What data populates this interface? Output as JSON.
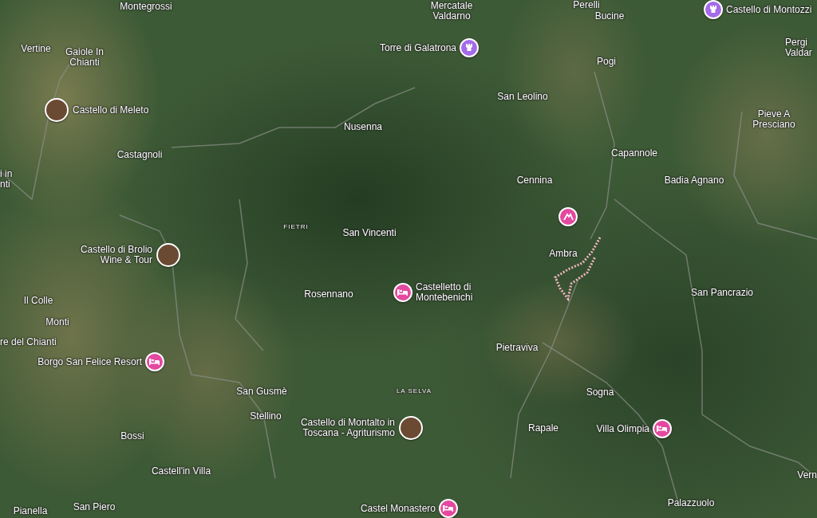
{
  "map": {
    "places": [
      {
        "name": "Montegrossi",
        "kind": "town"
      },
      {
        "name": "Mercatale Valdarno",
        "kind": "town"
      },
      {
        "name": "Perelli",
        "kind": "town"
      },
      {
        "name": "Bucine",
        "kind": "town"
      },
      {
        "name": "Pergi Valdar",
        "kind": "town"
      },
      {
        "name": "Vertine",
        "kind": "town"
      },
      {
        "name": "Gaiole In Chianti",
        "kind": "town"
      },
      {
        "name": "Pogi",
        "kind": "town"
      },
      {
        "name": "San Leolino",
        "kind": "town"
      },
      {
        "name": "Nusenna",
        "kind": "town"
      },
      {
        "name": "Pieve A Presciano",
        "kind": "town"
      },
      {
        "name": "Capannole",
        "kind": "town"
      },
      {
        "name": "Castagnoli",
        "kind": "town"
      },
      {
        "name": "i in nti",
        "kind": "town"
      },
      {
        "name": "Cennina",
        "kind": "town"
      },
      {
        "name": "Badia Agnano",
        "kind": "town"
      },
      {
        "name": "FIETRI",
        "kind": "area"
      },
      {
        "name": "San Vincenti",
        "kind": "town"
      },
      {
        "name": "Ambra",
        "kind": "town"
      },
      {
        "name": "Rosennano",
        "kind": "town"
      },
      {
        "name": "San Pancrazio",
        "kind": "town"
      },
      {
        "name": "Il Colle",
        "kind": "town"
      },
      {
        "name": "Monti",
        "kind": "town"
      },
      {
        "name": "re del Chianti",
        "kind": "town"
      },
      {
        "name": "Pietraviva",
        "kind": "town"
      },
      {
        "name": "San Gusmè",
        "kind": "town"
      },
      {
        "name": "LA SELVA",
        "kind": "area"
      },
      {
        "name": "Sogna",
        "kind": "town"
      },
      {
        "name": "Stellino",
        "kind": "town"
      },
      {
        "name": "Rapale",
        "kind": "town"
      },
      {
        "name": "Bossi",
        "kind": "town"
      },
      {
        "name": "Castell'in Villa",
        "kind": "town"
      },
      {
        "name": "Vern",
        "kind": "town"
      },
      {
        "name": "San Piero",
        "kind": "town"
      },
      {
        "name": "Palazzuolo",
        "kind": "town"
      },
      {
        "name": "Pianella",
        "kind": "town"
      }
    ],
    "pins": [
      {
        "label": "Castello di Montozzi",
        "kind": "castle"
      },
      {
        "label": "Torre di Galatrona",
        "kind": "castle"
      },
      {
        "label": "Castello di Meleto",
        "kind": "photo"
      },
      {
        "kind": "activity"
      },
      {
        "label": "Castello di Brolio Wine & Tour",
        "kind": "photo"
      },
      {
        "label": "Castelletto di Montebenichi",
        "kind": "hotel"
      },
      {
        "label": "Borgo San Felice Resort",
        "kind": "hotel"
      },
      {
        "label": "Castello di Montalto in Toscana - Agriturismo",
        "kind": "photo"
      },
      {
        "label": "Villa Olimpia",
        "kind": "hotel"
      },
      {
        "label": "Castel Monastero",
        "kind": "hotel"
      }
    ]
  }
}
